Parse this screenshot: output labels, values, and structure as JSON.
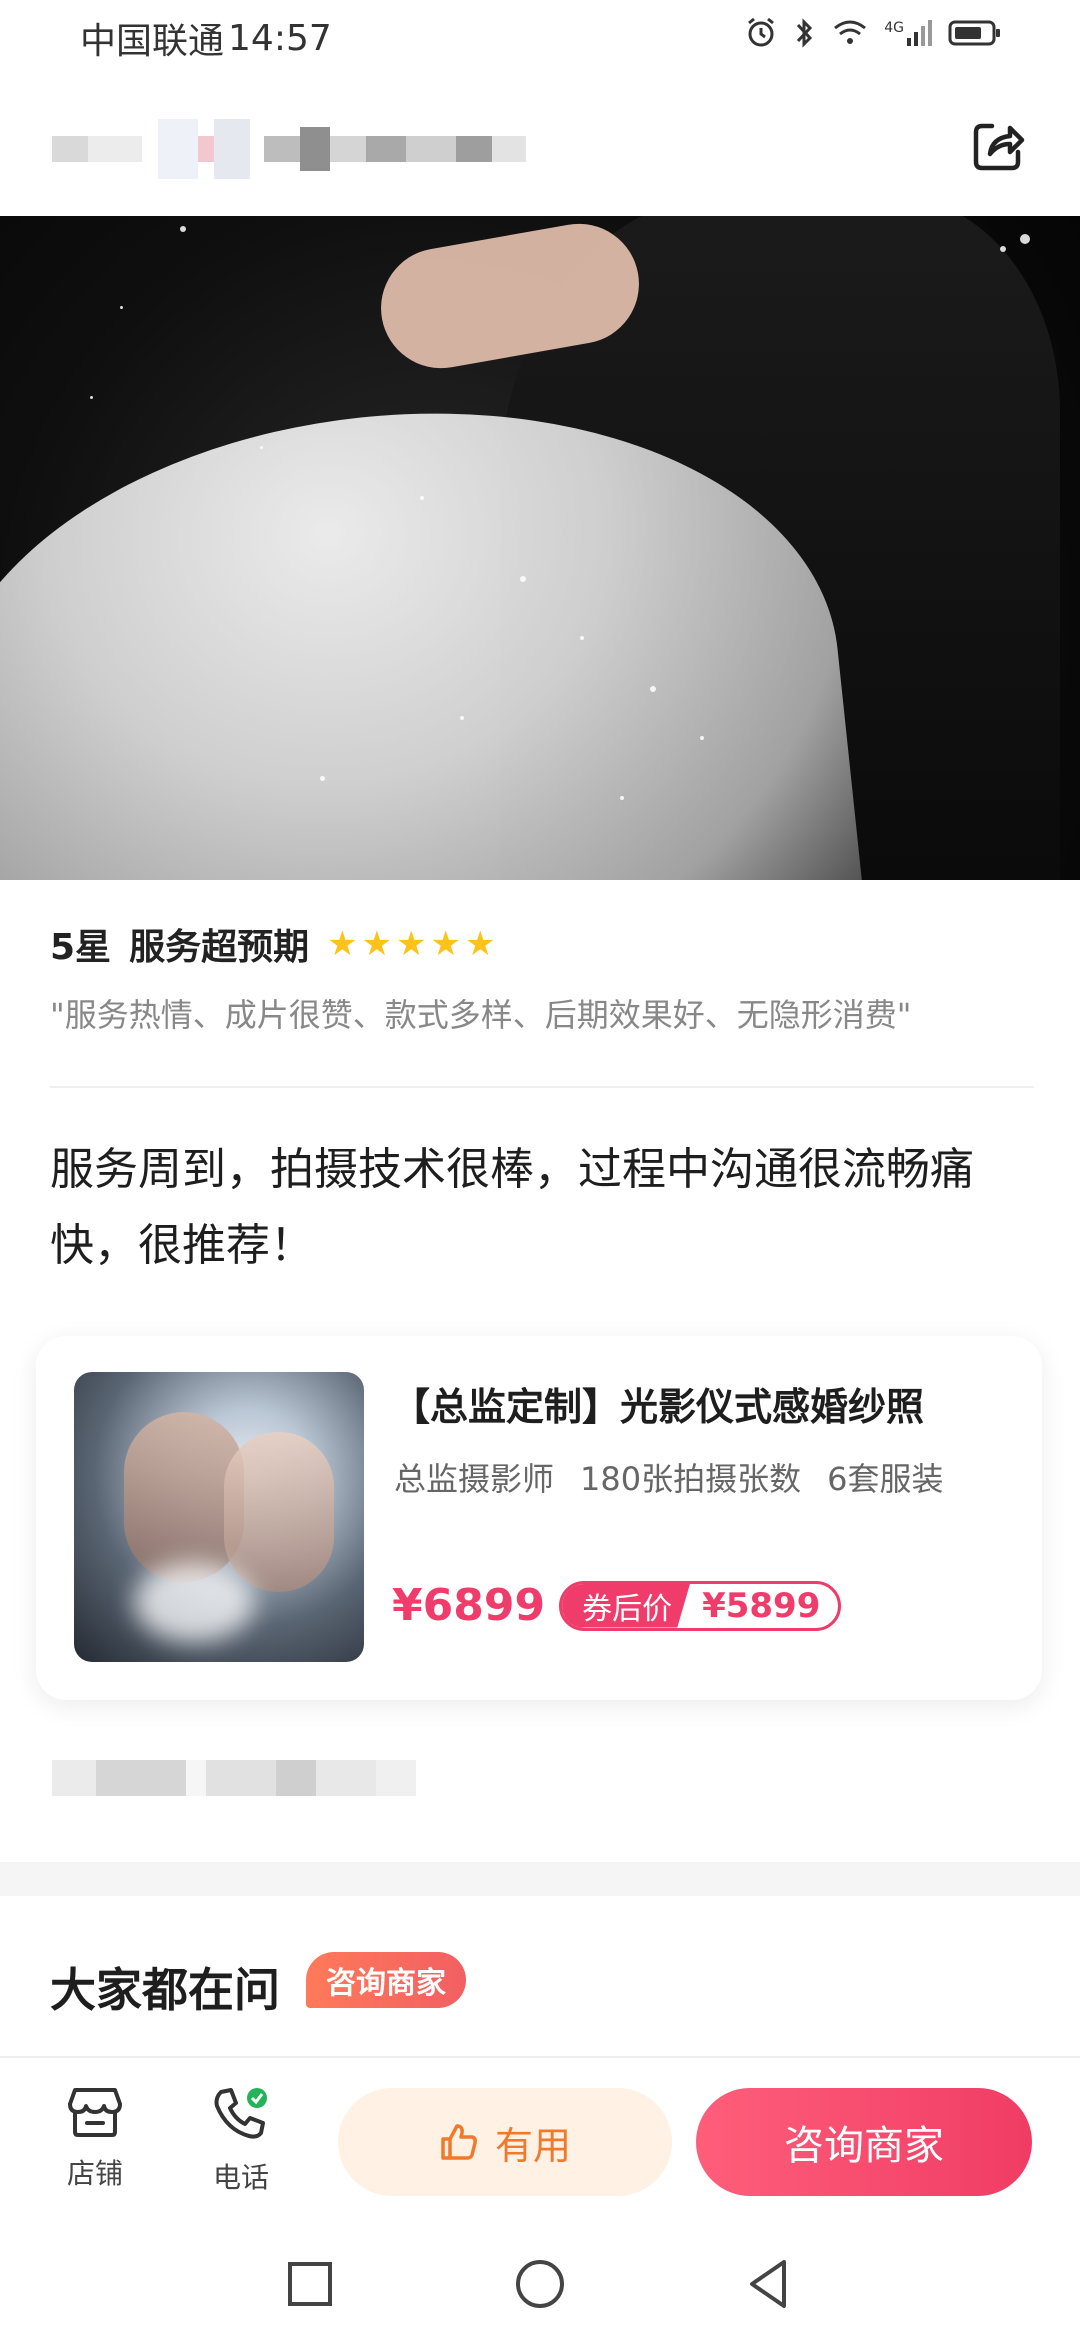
{
  "status_bar": {
    "carrier": "中国联通",
    "time": "14:57",
    "network": "4G",
    "icons": [
      "alarm-icon",
      "bluetooth-icon",
      "wifi-icon",
      "signal-icon",
      "battery-icon"
    ]
  },
  "header": {
    "share_icon": "share-icon"
  },
  "review": {
    "rating_label": "5星",
    "rating_summary": "服务超预期",
    "stars": 5,
    "tags": "\"服务热情、成片很赞、款式多样、后期效果好、无隐形消费\"",
    "text": "服务周到，拍摄技术很棒，过程中沟通很流畅痛快，很推荐！"
  },
  "product": {
    "title": "【总监定制】光影仪式感婚纱照",
    "specs": [
      "总监摄影师",
      "180张拍摄张数",
      "6套服装"
    ],
    "price": "¥6899",
    "coupon_label": "券后价",
    "coupon_price": "¥5899"
  },
  "qa": {
    "title": "大家都在问",
    "tag": "咨询商家"
  },
  "bottom_bar": {
    "store_label": "店铺",
    "phone_label": "电话",
    "useful_label": "有用",
    "consult_label": "咨询商家"
  },
  "colors": {
    "accent": "#f03c6a",
    "star": "#ffc21a",
    "useful_text": "#ef7a2c",
    "useful_bg": "#fff1e4"
  }
}
